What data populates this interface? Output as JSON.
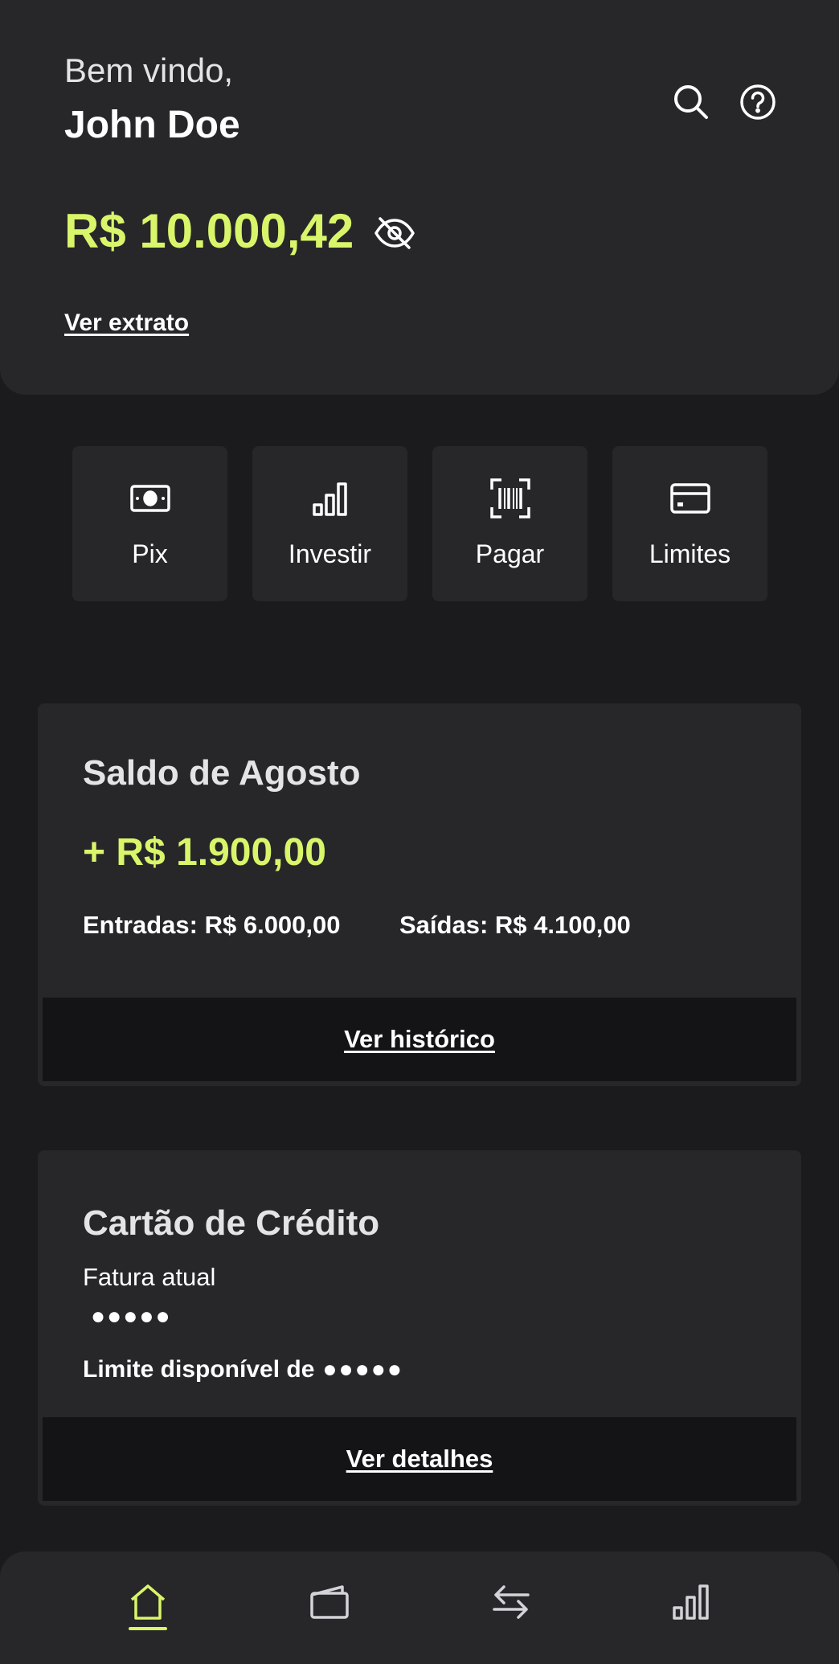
{
  "header": {
    "greeting": "Bem vindo,",
    "user_name": "John Doe",
    "balance": "R$ 10.000,42",
    "statement_link": "Ver extrato",
    "icons": [
      "search-icon",
      "help-icon",
      "eye-off-icon"
    ]
  },
  "quick_actions": [
    {
      "label": "Pix",
      "icon": "cash-icon"
    },
    {
      "label": "Investir",
      "icon": "bar-chart-icon"
    },
    {
      "label": "Pagar",
      "icon": "barcode-icon"
    },
    {
      "label": "Limites",
      "icon": "credit-card-icon"
    }
  ],
  "monthly_summary": {
    "title": "Saldo de Agosto",
    "net": "+ R$ 1.900,00",
    "income": "Entradas: R$ 6.000,00",
    "expenses": "Saídas: R$ 4.100,00",
    "footer_link": "Ver histórico"
  },
  "credit_card": {
    "title": "Cartão de Crédito",
    "invoice_label": "Fatura atual",
    "invoice_value": "●●●●●",
    "limit_label": "Limite disponível de",
    "limit_value": "●●●●●",
    "footer_link": "Ver detalhes"
  },
  "bottom_nav": {
    "items": [
      "home-icon",
      "wallet-icon",
      "transfer-icon",
      "bar-chart-icon"
    ],
    "active": "home-icon"
  },
  "colors": {
    "accent": "#d9f56a",
    "surface": "#27272a",
    "background": "#1b1b1d",
    "footer": "#141416"
  }
}
